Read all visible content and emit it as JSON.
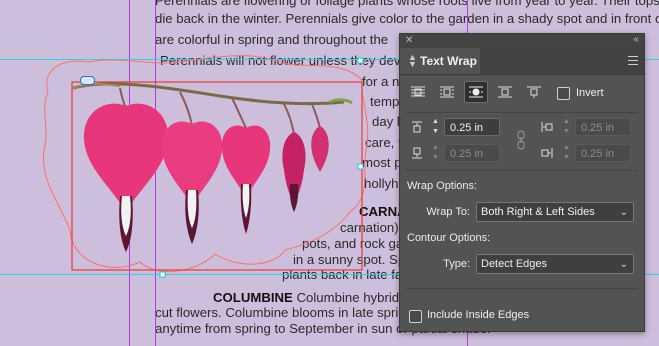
{
  "document": {
    "lines": [
      {
        "text": "Perennials are flowering or foliage plants whose roots live from year to year. Their tops may"
      },
      {
        "text": "die back in the winter. Perennials give color to the garden in a shady spot and in front of"
      },
      {
        "text": "are colorful in spring and throughout the"
      },
      {
        "text": "Perennials will not flower unless they deve"
      },
      {
        "text": "for a n"
      },
      {
        "text": "temp"
      },
      {
        "text": "day l"
      },
      {
        "text": "care, t"
      },
      {
        "text": "most p"
      },
      {
        "text": "hollyh"
      },
      {
        "bold": "CARNA",
        "text": ""
      },
      {
        "text": "carnation)"
      },
      {
        "text": "pots, and rock gar"
      },
      {
        "text": "in a sunny spot. Spac"
      },
      {
        "text": "plants back in late fall,"
      },
      {
        "bold": "COLUMBINE",
        "text": " Columbine hybrids (A"
      },
      {
        "text": "cut flowers. Columbine blooms in late spring"
      },
      {
        "text": "anytime from spring to September in sun or partial shade."
      }
    ]
  },
  "panel": {
    "title": "Text Wrap",
    "wrap_buttons": [
      {
        "name": "no-text-wrap",
        "active": false
      },
      {
        "name": "wrap-around-bounding-box",
        "active": false
      },
      {
        "name": "wrap-around-object-shape",
        "active": true
      },
      {
        "name": "jump-object",
        "active": false
      },
      {
        "name": "jump-to-next-column",
        "active": false
      }
    ],
    "invert_label": "Invert",
    "top_offset": "0.25 in",
    "bottom_offset": "0.25 in",
    "left_offset": "0.25 in",
    "right_offset": "0.25 in",
    "wrap_options_label": "Wrap Options:",
    "wrap_to_label": "Wrap To:",
    "wrap_to_value": "Both Right & Left Sides",
    "contour_options_label": "Contour Options:",
    "type_label": "Type:",
    "type_value": "Detect Edges",
    "include_inside_edges_label": "Include Inside Edges"
  },
  "colors": {
    "pasteboard": "#cdbfdc",
    "panel_bg": "#535353",
    "guide_cyan": "#28d3e8",
    "guide_magenta": "#b23ee0",
    "frame_red": "#e8383a",
    "flower_pink": "#e8367a"
  }
}
